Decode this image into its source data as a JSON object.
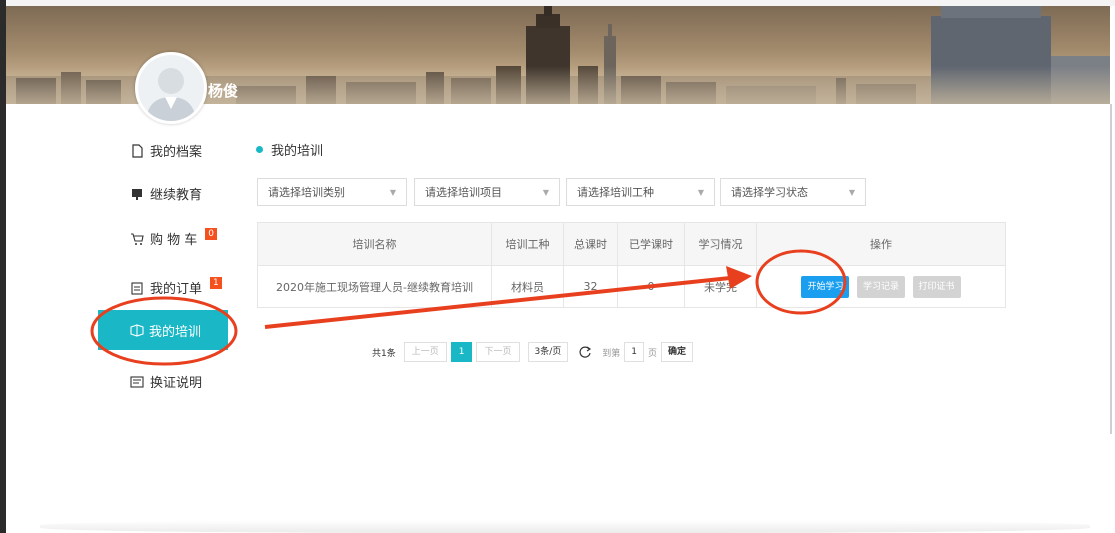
{
  "user": {
    "name": "杨俊"
  },
  "sidebar": {
    "items": [
      {
        "label": "我的档案",
        "icon": "document-icon"
      },
      {
        "label": "继续教育",
        "icon": "education-icon"
      },
      {
        "label": "购 物 车",
        "icon": "cart-icon",
        "badge": "0"
      },
      {
        "label": "我的订单",
        "icon": "order-icon",
        "badge": "1"
      },
      {
        "label": "我的培训",
        "icon": "training-icon",
        "active": true
      },
      {
        "label": "换证说明",
        "icon": "certificate-icon"
      }
    ]
  },
  "main": {
    "title": "我的培训",
    "filters": [
      {
        "placeholder": "请选择培训类别"
      },
      {
        "placeholder": "请选择培训项目"
      },
      {
        "placeholder": "请选择培训工种"
      },
      {
        "placeholder": "请选择学习状态"
      }
    ],
    "table": {
      "headers": [
        "培训名称",
        "培训工种",
        "总课时",
        "已学课时",
        "学习情况",
        "操作"
      ],
      "rows": [
        {
          "name": "2020年施工现场管理人员-继续教育培训",
          "type": "材料员",
          "total": "32",
          "learned": "0",
          "status": "未学完",
          "actions": [
            "开始学习",
            "学习记录",
            "打印证书"
          ]
        }
      ]
    },
    "pager": {
      "total": "共1条",
      "prev": "上一页",
      "current": "1",
      "next": "下一页",
      "per_page": "3条/页",
      "goto_label": "到第",
      "goto_value": "1",
      "page_unit": "页",
      "confirm": "确定"
    }
  },
  "colors": {
    "accent": "#1ab8c6",
    "primary_button": "#1a9ff0",
    "badge": "#f4511e",
    "annotation": "#e8401f"
  }
}
